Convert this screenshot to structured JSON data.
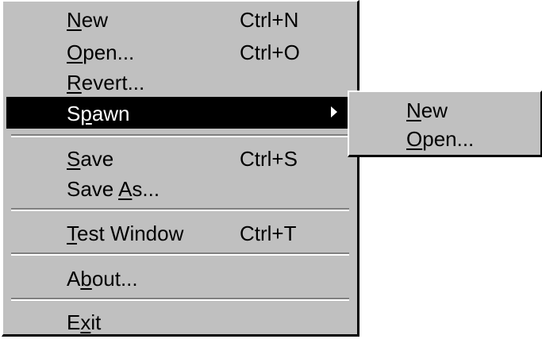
{
  "menu": {
    "items": [
      {
        "pre": "",
        "acc": "N",
        "post": "ew",
        "shortcut": "Ctrl+N"
      },
      {
        "pre": "",
        "acc": "O",
        "post": "pen...",
        "shortcut": "Ctrl+O"
      },
      {
        "pre": "",
        "acc": "R",
        "post": "evert...",
        "shortcut": ""
      },
      {
        "pre": "S",
        "acc": "p",
        "post": "awn",
        "shortcut": ""
      },
      {
        "pre": "",
        "acc": "S",
        "post": "ave",
        "shortcut": "Ctrl+S"
      },
      {
        "pre": "Save ",
        "acc": "A",
        "post": "s...",
        "shortcut": ""
      },
      {
        "pre": "",
        "acc": "T",
        "post": "est Window",
        "shortcut": "Ctrl+T"
      },
      {
        "pre": "A",
        "acc": "b",
        "post": "out...",
        "shortcut": ""
      },
      {
        "pre": "E",
        "acc": "x",
        "post": "it",
        "shortcut": ""
      }
    ]
  },
  "submenu": {
    "items": [
      {
        "pre": "",
        "acc": "N",
        "post": "ew"
      },
      {
        "pre": "",
        "acc": "O",
        "post": "pen..."
      }
    ]
  },
  "colors": {
    "menu_background": "#c0c0c0",
    "highlight_background": "#000000",
    "highlight_text": "#ffffff"
  }
}
